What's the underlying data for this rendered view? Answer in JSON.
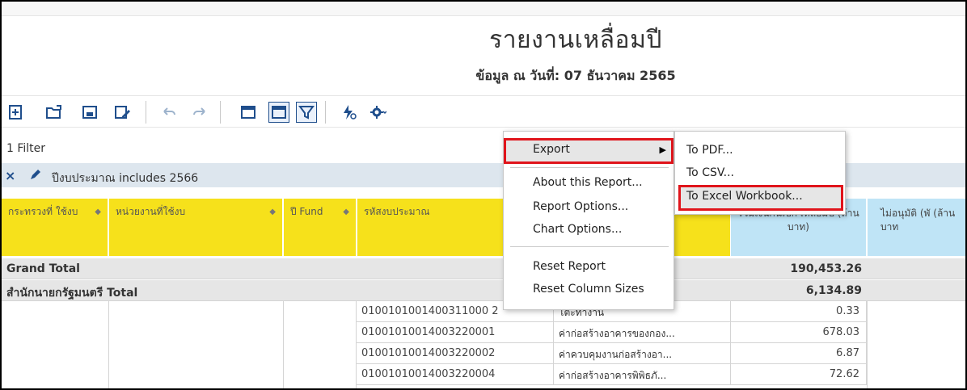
{
  "report": {
    "title": "รายงานเหลื่อมปี",
    "subtitle": "ข้อมูล ณ วันที่: 07 ธันวาคม 2565"
  },
  "toolbar": {
    "icons": [
      "new-report-icon",
      "open-icon",
      "save-icon",
      "save-as-icon",
      "undo-icon",
      "redo-icon",
      "layout-icon",
      "table-view-icon",
      "filter-icon",
      "flash-icon",
      "settings-icon"
    ]
  },
  "filters": {
    "count_label": "1 Filter",
    "active_filter": "ปีงบประมาณ includes 2566"
  },
  "table": {
    "columns": [
      {
        "label": "กระทรวงที่ ใช้งบ"
      },
      {
        "label": "หน่วยงานที่ใช้งบ"
      },
      {
        "label": "ปี Fund"
      },
      {
        "label": "รหัสงบประมาณ"
      },
      {
        "label": "รวมเงินกันเบิก เหลื่อมปี (ล้านบาท)"
      },
      {
        "label": "ไม่อนุมัติ (พั (ล้านบาท"
      }
    ],
    "grand_total": {
      "label": "Grand Total",
      "value": "190,453.26"
    },
    "subtotal": {
      "label": "สำนักนายกรัฐมนตรี Total",
      "value": "6,134.89"
    },
    "rows": [
      {
        "code": "0100101001400311000 2",
        "name": "โต๊ะทำงาน",
        "value": "0.33"
      },
      {
        "code": "01001010014003220001",
        "name": "ค่าก่อสร้างอาคารของกอง...",
        "value": "678.03"
      },
      {
        "code": "01001010014003220002",
        "name": "ค่าควบคุมงานก่อสร้างอา...",
        "value": "6.87"
      },
      {
        "code": "01001010014003220004",
        "name": "ค่าก่อสร้างอาคารพิพิธภั...",
        "value": "72.62"
      }
    ]
  },
  "context_menu": {
    "export": "Export",
    "about": "About this Report...",
    "report_options": "Report Options...",
    "chart_options": "Chart Options...",
    "reset_report": "Reset Report",
    "reset_columns": "Reset Column Sizes"
  },
  "export_submenu": {
    "pdf": "To PDF...",
    "csv": "To CSV...",
    "excel": "To Excel Workbook..."
  },
  "colors": {
    "header_yellow": "#f6e11b",
    "header_blue": "#bfe4f6",
    "highlight_red": "#e0141b",
    "accent": "#1f4e8c"
  }
}
